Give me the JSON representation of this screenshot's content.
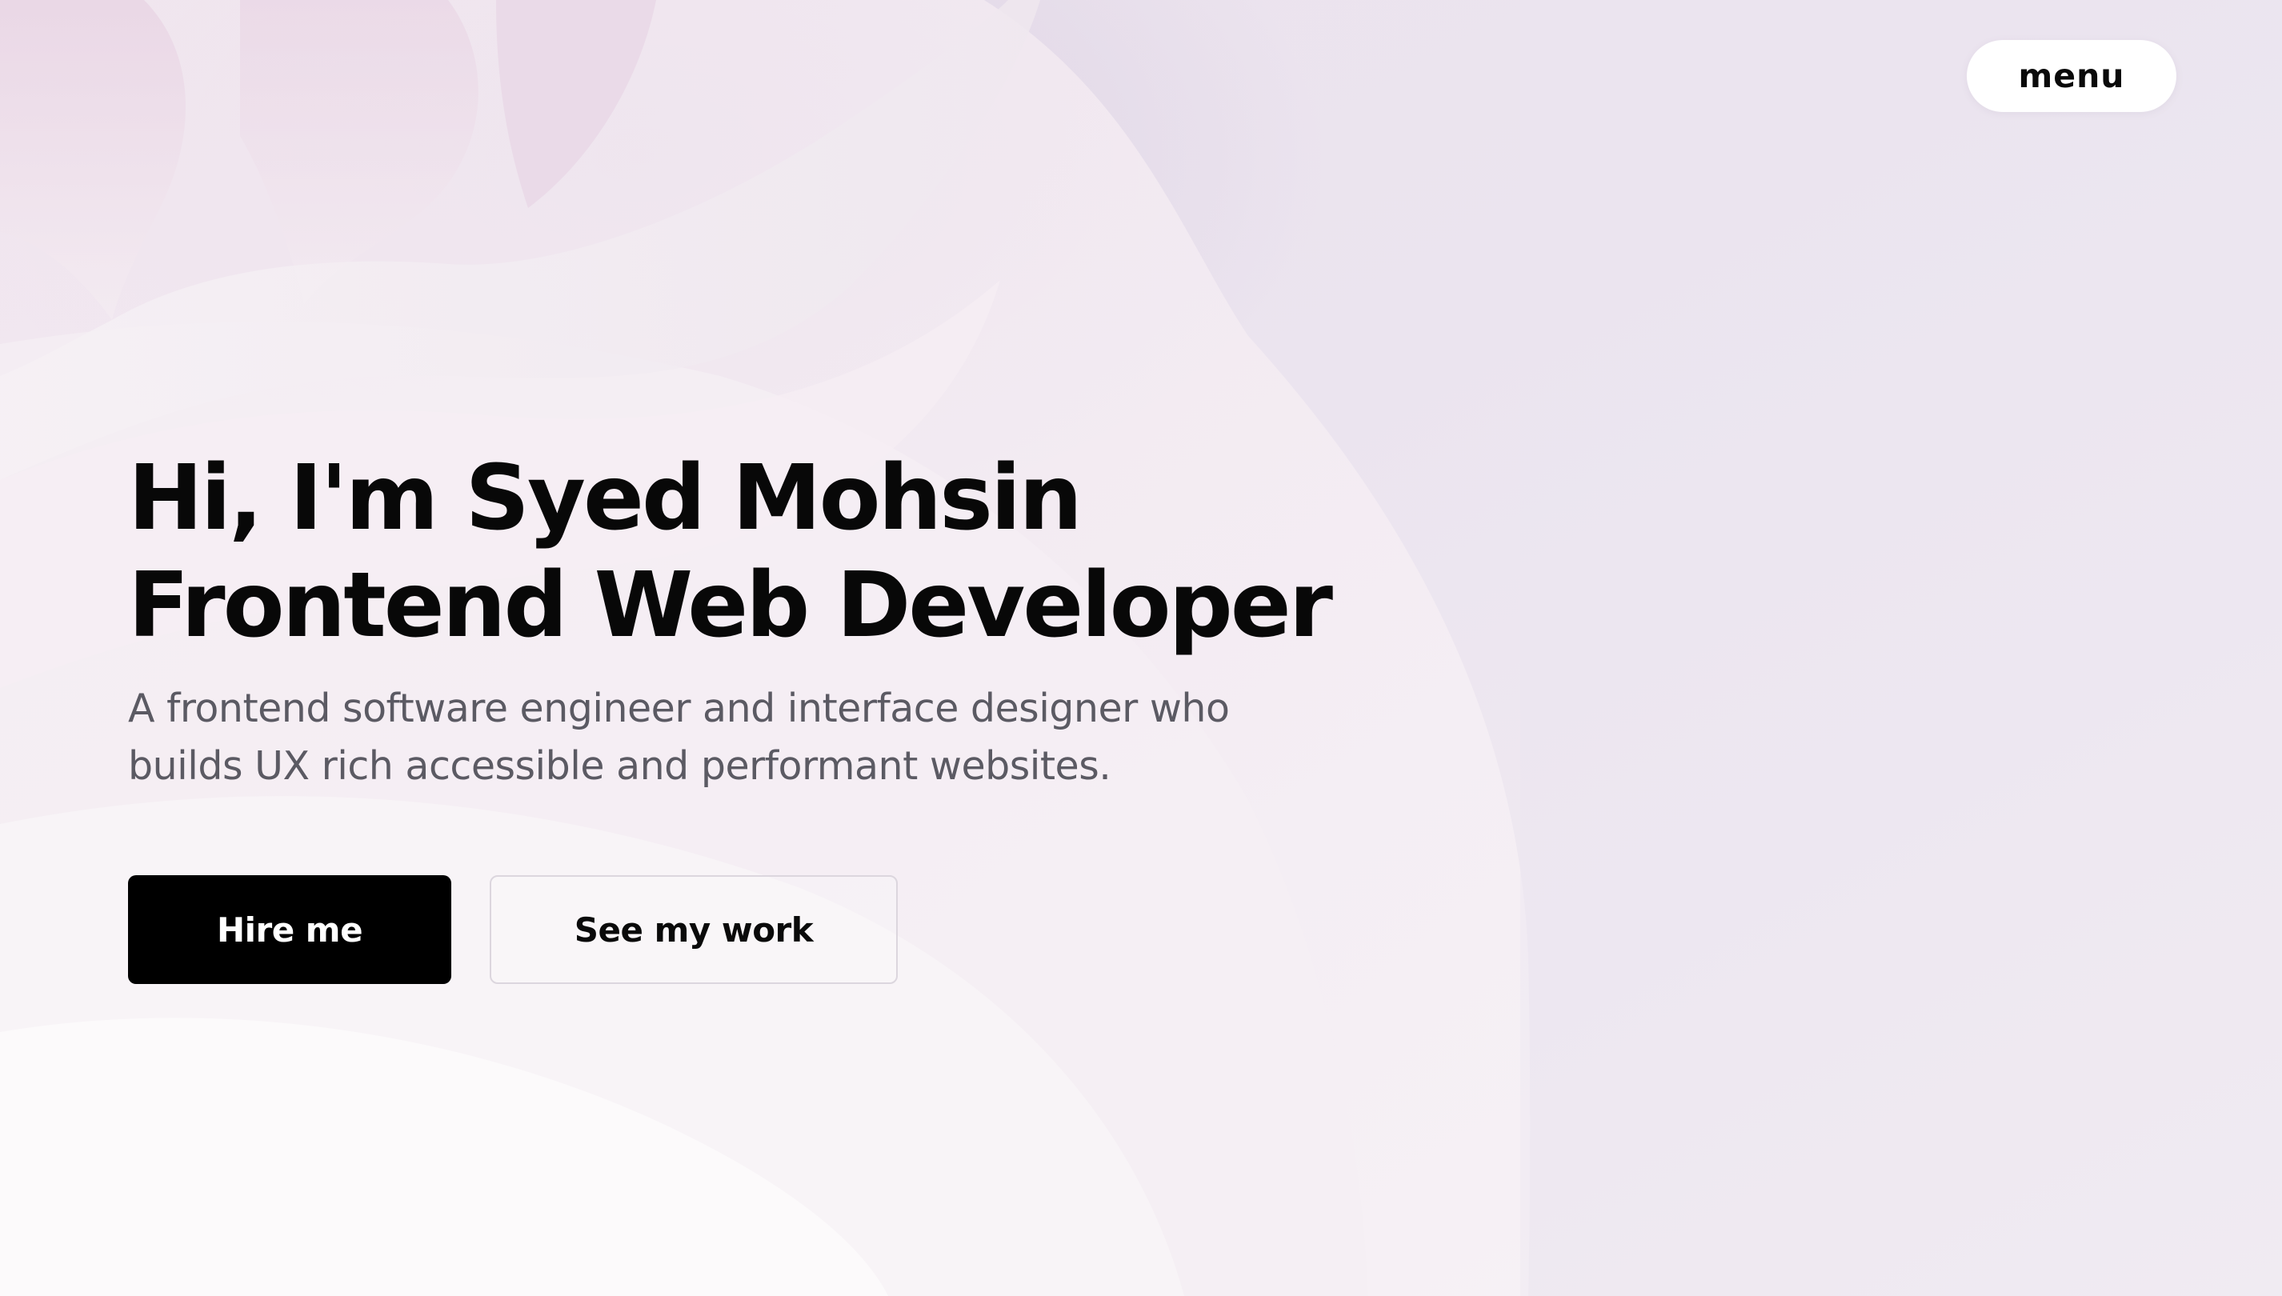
{
  "nav": {
    "menu_label": "menu"
  },
  "hero": {
    "title_line1": "Hi, I'm Syed Mohsin",
    "title_line2": "Frontend Web Developer",
    "description": "A frontend software engineer and interface designer who builds UX rich accessible and performant websites."
  },
  "actions": {
    "primary_label": "Hire me",
    "secondary_label": "See my work"
  },
  "colors": {
    "background": "#efe8f0",
    "primary_button": "#000000",
    "text": "#080808",
    "muted_text": "#5b5a63"
  }
}
